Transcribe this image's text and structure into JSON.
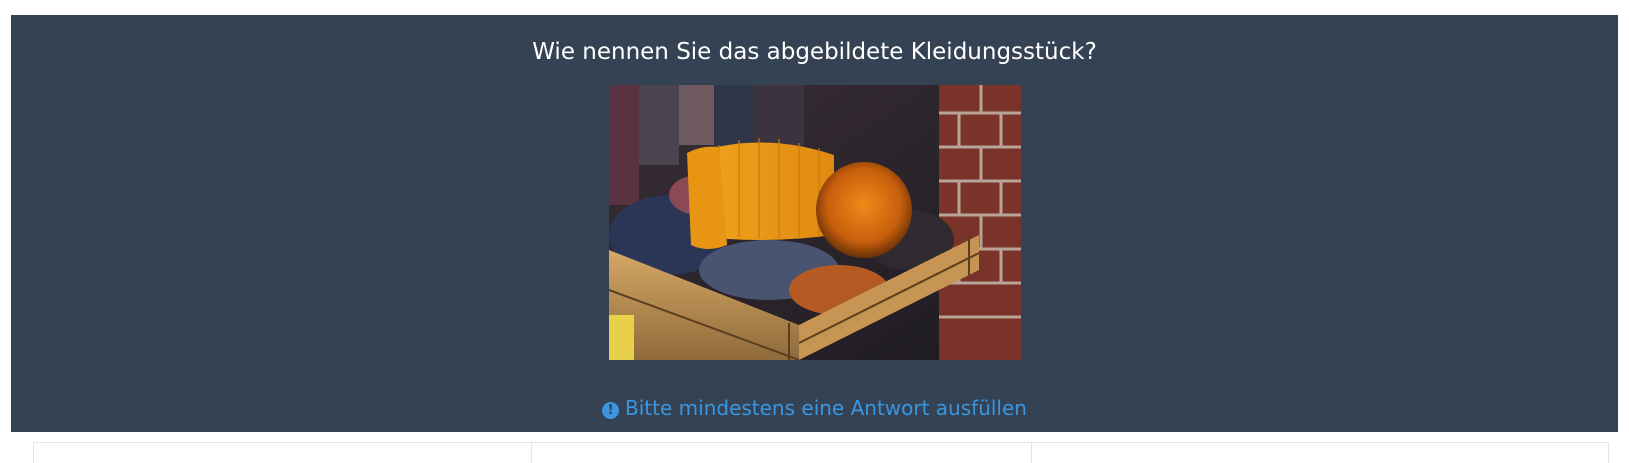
{
  "question": {
    "title": "Wie nennen Sie das abgebildete Kleidungsstück?",
    "hint_icon": "exclamation-circle-icon",
    "hint_text": "Bitte mindestens eine Antwort ausfüllen"
  },
  "colors": {
    "panel_background": "#344254",
    "title_text": "#ffffff",
    "hint_text": "#3b96e0",
    "page_background": "#ffffff"
  },
  "answers": {
    "field_count": 3
  }
}
